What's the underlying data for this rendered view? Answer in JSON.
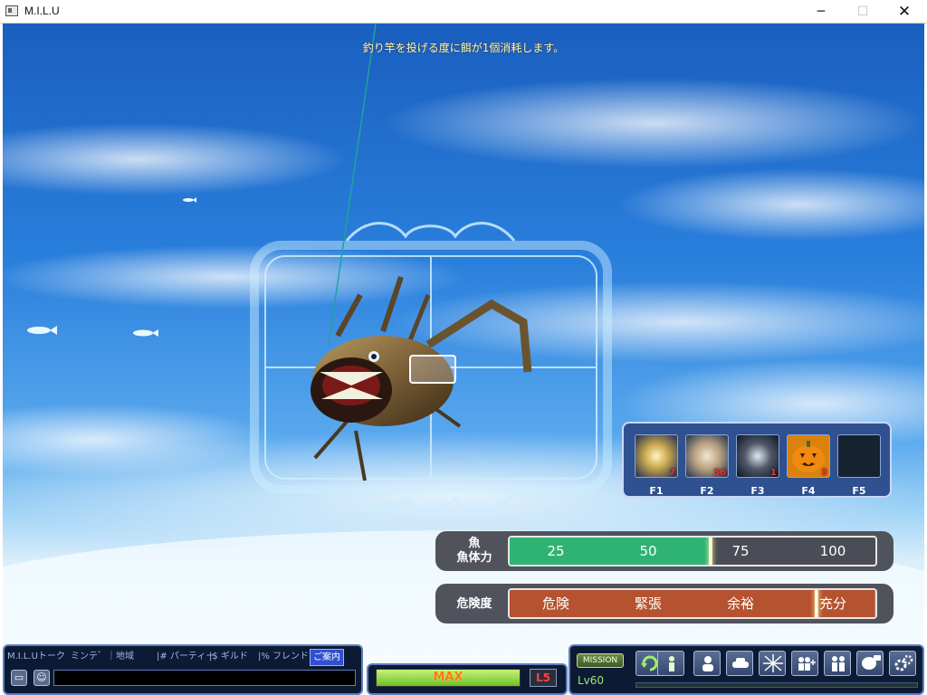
{
  "window": {
    "title": "M.I.L.U",
    "minimize": "─",
    "maximize": "☐",
    "close": "✕"
  },
  "hint_text": "釣り竿を投げる度に餌が1個消耗します。",
  "skills": [
    {
      "key": "F1",
      "count": "7",
      "icon": "sparkle-orb-icon"
    },
    {
      "key": "F2",
      "count": "56",
      "icon": "glow-orb-icon"
    },
    {
      "key": "F3",
      "count": "1",
      "icon": "dark-orb-icon"
    },
    {
      "key": "F4",
      "count": "3",
      "icon": "pumpkin-icon"
    },
    {
      "key": "F5",
      "count": "",
      "icon": "empty-slot"
    }
  ],
  "fish_gauge": {
    "label_line1": "魚",
    "label_line2": "魚体力",
    "ticks": [
      "25",
      "50",
      "75",
      "100"
    ],
    "fill_color": "#2fb373",
    "empty_color": "#4a4d55",
    "value_percent": 55
  },
  "danger_gauge": {
    "label": "危険度",
    "zones": [
      "危険",
      "緊張",
      "余裕",
      "充分"
    ],
    "fill_color": "#b5522f",
    "value_percent": 84
  },
  "chat": {
    "tabs": [
      "M.I.L.Uトーク",
      "ミンテ゛",
      "｜地域",
      "|# パーティー",
      "|$ ギルド",
      "|% フレンド",
      "ご案内"
    ],
    "active_tab": "ご案内",
    "btn1_icon": "window-icon",
    "btn2_icon": "smiley-icon"
  },
  "energy": {
    "label": "MAX",
    "fill_percent": 100,
    "badge": "L5"
  },
  "menu": {
    "mission_label": "MISSION",
    "level": "Lv60",
    "buttons": [
      "return-icon",
      "character-icon",
      "profile-icon",
      "vehicle-icon",
      "map-icon",
      "add-friend-icon",
      "party-icon",
      "chat-bubble-icon",
      "settings-gears-icon"
    ],
    "xp_percent": 0
  },
  "colors": {
    "title_bar": "#ffffff",
    "panel_bg": "#0d1a33",
    "panel_border": "#5c7fbf",
    "hint_text": "#fff6b0"
  }
}
